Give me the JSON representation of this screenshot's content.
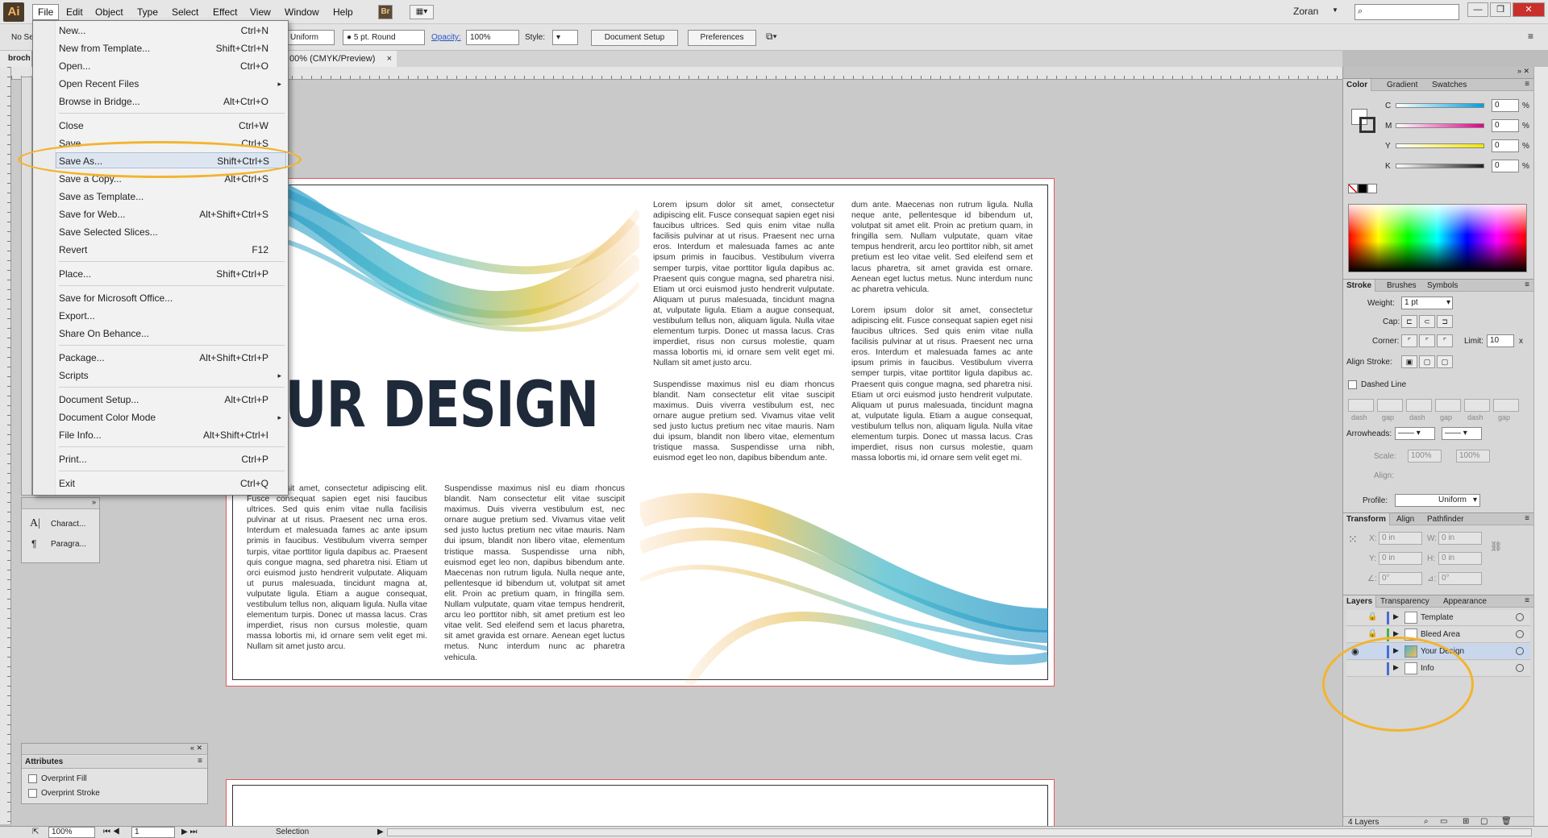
{
  "app": {
    "logo": "Ai",
    "user": "Zoran"
  },
  "menubar": [
    "File",
    "Edit",
    "Object",
    "Type",
    "Select",
    "Effect",
    "View",
    "Window",
    "Help"
  ],
  "menubar_extra": {
    "bridge": "Br"
  },
  "control": {
    "selection": "No Se",
    "stroke_profile": "Uniform",
    "brush": "5 pt. Round",
    "opacity_label": "Opacity:",
    "opacity_value": "100%",
    "style_label": "Style:",
    "doc_setup": "Document Setup",
    "preferences": "Preferences"
  },
  "document": {
    "tab_left": "broch",
    "tab_title": "00% (CMYK/Preview)",
    "tab_close": "×"
  },
  "file_menu": {
    "items": [
      {
        "label": "New...",
        "shortcut": "Ctrl+N"
      },
      {
        "label": "New from Template...",
        "shortcut": "Shift+Ctrl+N"
      },
      {
        "label": "Open...",
        "shortcut": "Ctrl+O"
      },
      {
        "label": "Open Recent Files",
        "shortcut": "",
        "submenu": "▸"
      },
      {
        "label": "Browse in Bridge...",
        "shortcut": "Alt+Ctrl+O"
      },
      {
        "label": "Close",
        "shortcut": "Ctrl+W"
      },
      {
        "label": "Save",
        "shortcut": "Ctrl+S"
      },
      {
        "label": "Save As...",
        "shortcut": "Shift+Ctrl+S"
      },
      {
        "label": "Save a Copy...",
        "shortcut": "Alt+Ctrl+S"
      },
      {
        "label": "Save as Template...",
        "shortcut": ""
      },
      {
        "label": "Save for Web...",
        "shortcut": "Alt+Shift+Ctrl+S"
      },
      {
        "label": "Save Selected Slices...",
        "shortcut": ""
      },
      {
        "label": "Revert",
        "shortcut": "F12"
      },
      {
        "label": "Place...",
        "shortcut": "Shift+Ctrl+P"
      },
      {
        "label": "Save for Microsoft Office...",
        "shortcut": ""
      },
      {
        "label": "Export...",
        "shortcut": ""
      },
      {
        "label": "Share On Behance...",
        "shortcut": ""
      },
      {
        "label": "Package...",
        "shortcut": "Alt+Shift+Ctrl+P"
      },
      {
        "label": "Scripts",
        "shortcut": "",
        "submenu": "▸"
      },
      {
        "label": "Document Setup...",
        "shortcut": "Alt+Ctrl+P"
      },
      {
        "label": "Document Color Mode",
        "shortcut": "",
        "submenu": "▸"
      },
      {
        "label": "File Info...",
        "shortcut": "Alt+Shift+Ctrl+I"
      },
      {
        "label": "Print...",
        "shortcut": "Ctrl+P"
      },
      {
        "label": "Exit",
        "shortcut": "Ctrl+Q"
      }
    ]
  },
  "artboard": {
    "headline": "OUR DESIGN",
    "col_top_1": "Lorem ipsum dolor sit amet, consectetur adipiscing elit. Fusce consequat sapien eget nisi faucibus ultrices. Sed quis enim vitae nulla facilisis pulvinar at ut risus. Praesent nec urna eros. Interdum et malesuada fames ac ante ipsum primis in faucibus. Vestibulum viverra semper turpis, vitae porttitor ligula dapibus ac. Praesent quis congue magna, sed pharetra nisi. Etiam ut orci euismod justo hendrerit vulputate. Aliquam ut purus malesuada, tincidunt magna at, vulputate ligula. Etiam a augue consequat, vestibulum tellus non, aliquam ligula. Nulla vitae elementum turpis. Donec ut massa lacus. Cras imperdiet, risus non cursus molestie, quam massa lobortis mi, id ornare sem velit eget mi. Nullam sit amet justo arcu.",
    "col_top_1b": "Suspendisse maximus nisl eu diam rhoncus blandit. Nam consectetur elit vitae suscipit maximus. Duis viverra vestibulum est, nec ornare augue pretium sed. Vivamus vitae velit sed justo luctus pretium nec vitae mauris. Nam dui ipsum, blandit non libero vitae, elementum tristique massa. Suspendisse urna nibh, euismod eget leo non, dapibus bibendum ante.",
    "col_top_2": "dum ante. Maecenas non rutrum ligula. Nulla neque ante, pellentesque id bibendum ut, volutpat sit amet elit. Proin ac pretium quam, in fringilla sem. Nullam vulputate, quam vitae tempus hendrerit, arcu leo porttitor nibh, sit amet pretium est leo vitae velit. Sed eleifend sem et lacus pharetra, sit amet gravida est ornare. Aenean eget luctus metus. Nunc interdum nunc ac pharetra vehicula.",
    "col_top_2b": "Lorem ipsum dolor sit amet, consectetur adipiscing elit. Fusce consequat sapien eget nisi faucibus ultrices. Sed quis enim vitae nulla facilisis pulvinar at ut risus. Praesent nec urna eros. Interdum et malesuada fames ac ante ipsum primis in faucibus. Vestibulum viverra semper turpis, vitae porttitor ligula dapibus ac. Praesent quis congue magna, sed pharetra nisi. Etiam ut orci euismod justo hendrerit vulputate. Aliquam ut purus malesuada, tincidunt magna at, vulputate ligula. Etiam a augue consequat, vestibulum tellus non, aliquam ligula. Nulla vitae elementum turpis. Donec ut massa lacus. Cras imperdiet, risus non cursus molestie, quam massa lobortis mi, id ornare sem velit eget mi.",
    "col_bot_1": "um dolor sit amet, consectetur adipiscing elit. Fusce consequat sapien eget nisi faucibus ultrices. Sed quis enim vitae nulla facilisis pulvinar at ut risus. Praesent nec urna eros. Interdum et malesuada fames ac ante ipsum primis in faucibus. Vestibulum viverra semper turpis, vitae porttitor ligula dapibus ac. Praesent quis congue magna, sed pharetra nisi. Etiam ut orci euismod justo hendrerit vulputate. Aliquam ut purus malesuada, tincidunt magna at, vulputate ligula. Etiam a augue consequat, vestibulum tellus non, aliquam ligula. Nulla vitae elementum turpis. Donec ut massa lacus. Cras imperdiet, risus non cursus molestie, quam massa lobortis mi, id ornare sem velit eget mi. Nullam sit amet justo arcu.",
    "col_bot_2": "Suspendisse maximus nisl eu diam rhoncus blandit. Nam consectetur elit vitae suscipit maximus. Duis viverra vestibulum est, nec ornare augue pretium sed. Vivamus vitae velit sed justo luctus pretium nec vitae mauris. Nam dui ipsum, blandit non libero vitae, elementum tristique massa. Suspendisse urna nibh, euismod eget leo non, dapibus bibendum ante. Maecenas non rutrum ligula. Nulla neque ante, pellentesque id bibendum ut, volutpat sit amet elit. Proin ac pretium quam, in fringilla sem. Nullam vulputate, quam vitae tempus hendrerit, arcu leo porttitor nibh, sit amet pretium est leo vitae velit. Sed eleifend sem et lacus pharetra, sit amet gravida est ornare. Aenean eget luctus metus. Nunc interdum nunc ac pharetra vehicula."
  },
  "left_panels": {
    "char": "Charact...",
    "para": "Paragra...",
    "attributes_title": "Attributes",
    "overprint_fill": "Overprint Fill",
    "overprint_stroke": "Overprint Stroke"
  },
  "color_panel": {
    "tabs": [
      "Color",
      "Gradient",
      "Swatches"
    ],
    "channels": [
      {
        "name": "C",
        "value": "0",
        "unit": "%",
        "color": "#00a0e0"
      },
      {
        "name": "M",
        "value": "0",
        "unit": "%",
        "color": "#e0008a"
      },
      {
        "name": "Y",
        "value": "0",
        "unit": "%",
        "color": "#f2e400"
      },
      {
        "name": "K",
        "value": "0",
        "unit": "%",
        "color": "#222222"
      }
    ]
  },
  "stroke_panel": {
    "tabs": [
      "Stroke",
      "Brushes",
      "Symbols"
    ],
    "weight_label": "Weight:",
    "weight_value": "1 pt",
    "cap_label": "Cap:",
    "corner_label": "Corner:",
    "limit_label": "Limit:",
    "limit_value": "10",
    "limit_unit": "x",
    "align_label": "Align Stroke:",
    "dashed_label": "Dashed Line",
    "dash_labels": [
      "dash",
      "gap",
      "dash",
      "gap",
      "dash",
      "gap"
    ],
    "arrowheads_label": "Arrowheads:",
    "scale_label": "Scale:",
    "scale_1": "100%",
    "scale_2": "100%",
    "align_arrows_label": "Align:",
    "profile_label": "Profile:",
    "profile_value": "Uniform"
  },
  "transform_panel": {
    "tabs": [
      "Transform",
      "Align",
      "Pathfinder"
    ],
    "x_label": "X:",
    "x_value": "0 in",
    "y_label": "Y:",
    "y_value": "0 in",
    "w_label": "W:",
    "w_value": "0 in",
    "h_label": "H:",
    "h_value": "0 in",
    "rot_label": "∠:",
    "rot_value": "0°",
    "shear_label": "⊿:",
    "shear_value": "0°"
  },
  "layers_panel": {
    "tabs": [
      "Layers",
      "Transparency",
      "Appearance"
    ],
    "layers": [
      {
        "name": "Template",
        "color": "#4a6cd4",
        "visible": false
      },
      {
        "name": "Bleed Area",
        "color": "#3fb54a",
        "visible": false
      },
      {
        "name": "Your Design",
        "color": "#4a6cd4",
        "visible": true
      },
      {
        "name": "Info",
        "color": "#4a6cd4",
        "visible": false
      }
    ],
    "count": "4 Layers"
  },
  "statusbar": {
    "zoom": "100%",
    "page": "1",
    "tool": "Selection"
  }
}
